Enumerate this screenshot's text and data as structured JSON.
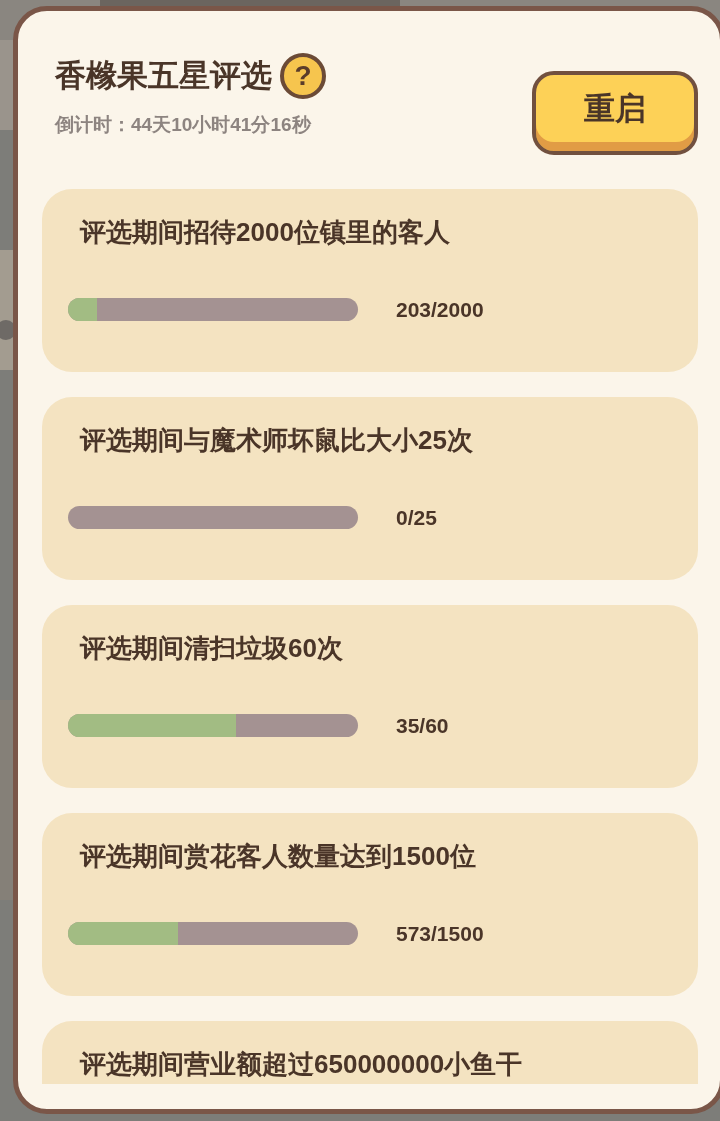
{
  "title": "香橼果五星评选",
  "help_icon": "?",
  "countdown": "倒计时：44天10小时41分16秒",
  "restart_button": "重启",
  "tasks": [
    {
      "title": "评选期间招待2000位镇里的客人",
      "level": 0.1,
      "progress": "203/2000"
    },
    {
      "title": "评选期间与魔术师坏鼠比大小25次",
      "level": 0,
      "progress": "0/25"
    },
    {
      "title": "评选期间清扫垃圾60次",
      "level": 0.58,
      "progress": "35/60"
    },
    {
      "title": "评选期间赏花客人数量达到1500位",
      "level": 0.38,
      "progress": "573/1500"
    },
    {
      "title": "评选期间营业额超过650000000小鱼干"
    }
  ]
}
